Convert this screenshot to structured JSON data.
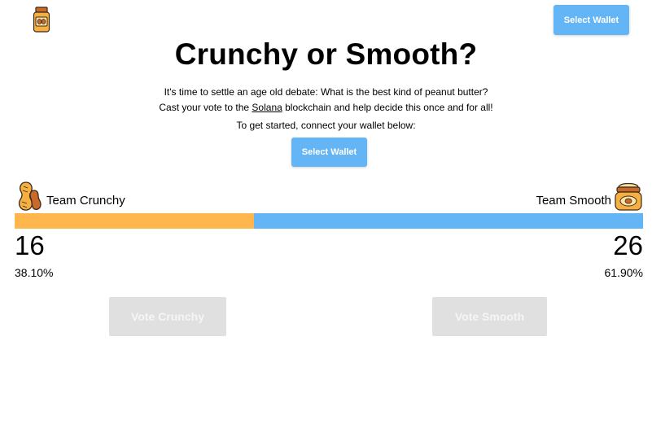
{
  "header": {
    "logo_icon": "peanut-butter-jar-icon",
    "wallet_button_label": "Select Wallet"
  },
  "main": {
    "title": "Crunchy or Smooth?",
    "intro_line1": "It's time to settle an age old debate: What is the best kind of peanut butter?",
    "intro_line2_before": "Cast your vote to the ",
    "intro_line2_link": "Solana",
    "intro_line2_after": " blockchain and help decide this once and for all!",
    "get_started": "To get started, connect your wallet below:",
    "wallet_button_label": "Select Wallet"
  },
  "teams": {
    "crunchy": {
      "label": "Team Crunchy",
      "icon": "peanut-icon",
      "votes": "16",
      "percent": "38.10%",
      "share": 0.381,
      "color": "#ffb74d",
      "vote_button_label": "Vote Crunchy"
    },
    "smooth": {
      "label": "Team Smooth",
      "icon": "peanut-butter-jar-icon",
      "votes": "26",
      "percent": "61.90%",
      "share": 0.619,
      "color": "#64b5f6",
      "vote_button_label": "Vote Smooth"
    }
  },
  "colors": {
    "accent_blue": "#64b5f6",
    "accent_orange": "#ffb74d",
    "disabled_button": "#e0e0e0"
  }
}
